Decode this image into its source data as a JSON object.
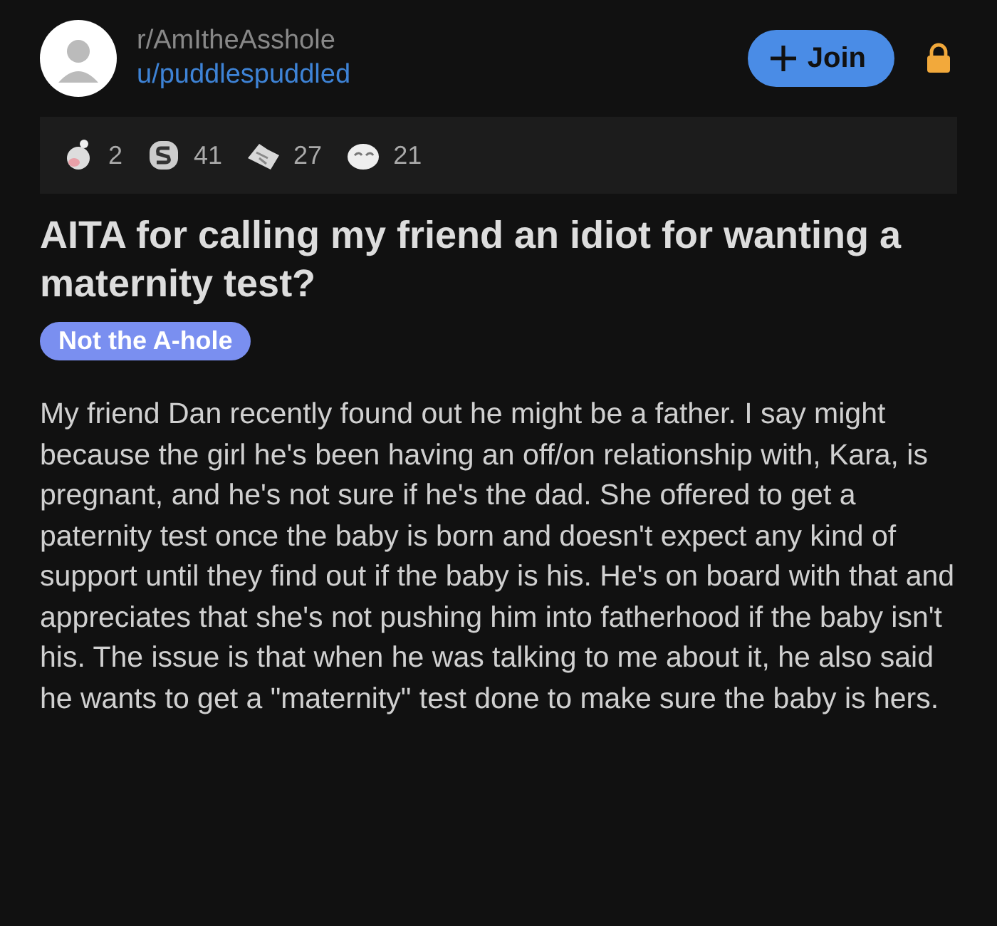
{
  "header": {
    "subreddit": "r/AmItheAsshole",
    "user": "u/puddlespuddled",
    "join_button": "Join",
    "locked": true
  },
  "awards": [
    {
      "count": "2"
    },
    {
      "count": "41"
    },
    {
      "count": "27"
    },
    {
      "count": "21"
    }
  ],
  "post": {
    "title": "AITA for calling my friend an idiot for wanting a maternity test?",
    "flair": "Not the A-hole",
    "body": "My friend Dan recently found out he might be a father. I say might because the girl he's been having an off/on relationship with, Kara, is pregnant, and he's not sure if he's the dad. She offered to get a paternity test once the baby is born and doesn't expect any kind of support until they find out if the baby is his. He's on board with that and appreciates that she's not pushing him into fatherhood if the baby isn't his. The issue is that when he was talking to me about it, he also said he wants to get a \"maternity\" test done to make sure the baby is hers."
  }
}
